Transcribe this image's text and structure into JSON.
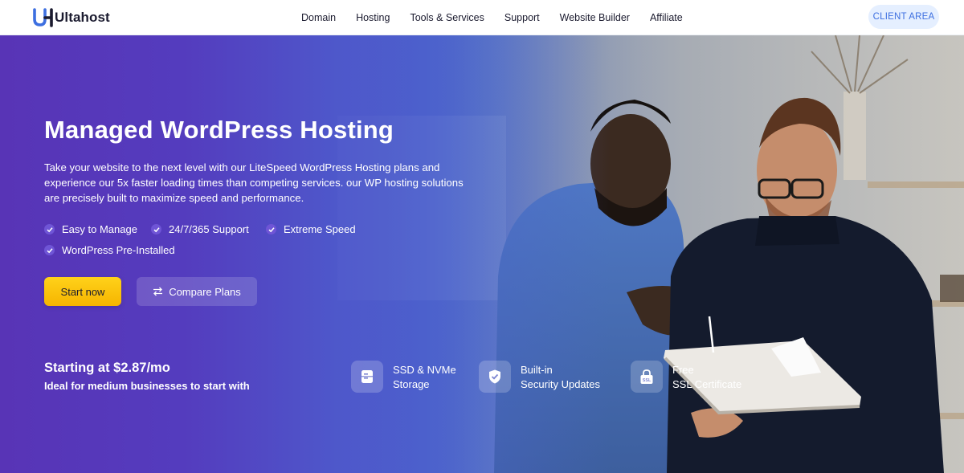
{
  "nav": {
    "logo_text": "Ultahost",
    "menu": [
      "Domain",
      "Hosting",
      "Tools & Services",
      "Support",
      "Website Builder",
      "Affiliate"
    ],
    "client_area": "CLIENT AREA"
  },
  "hero": {
    "title": "Managed WordPress Hosting",
    "description": "Take your website to the next level with our LiteSpeed WordPress Hosting plans and experience our 5x faster loading times than competing services. our WP hosting solutions are precisely built to maximize speed and performance.",
    "features": [
      "Easy to Manage",
      "24/7/365 Support",
      "Extreme Speed",
      "WordPress Pre-Installed"
    ],
    "start_button": "Start now",
    "compare_button": "Compare Plans",
    "price": "Starting at $2.87/mo",
    "price_sub": "Ideal for medium businesses to start with",
    "badges": [
      {
        "line1": "SSD & NVMe",
        "line2": "Storage",
        "icon": "storage-icon"
      },
      {
        "line1": "Built-in",
        "line2": "Security Updates",
        "icon": "shield-check-icon"
      },
      {
        "line1": "Free",
        "line2": "SSL Certificate",
        "icon": "ssl-lock-icon",
        "icon_text": "SSL"
      }
    ]
  },
  "colors": {
    "brand_blue": "#3d6fe0",
    "hero_purple": "#5a33b5",
    "cta_yellow": "#ffc107"
  }
}
